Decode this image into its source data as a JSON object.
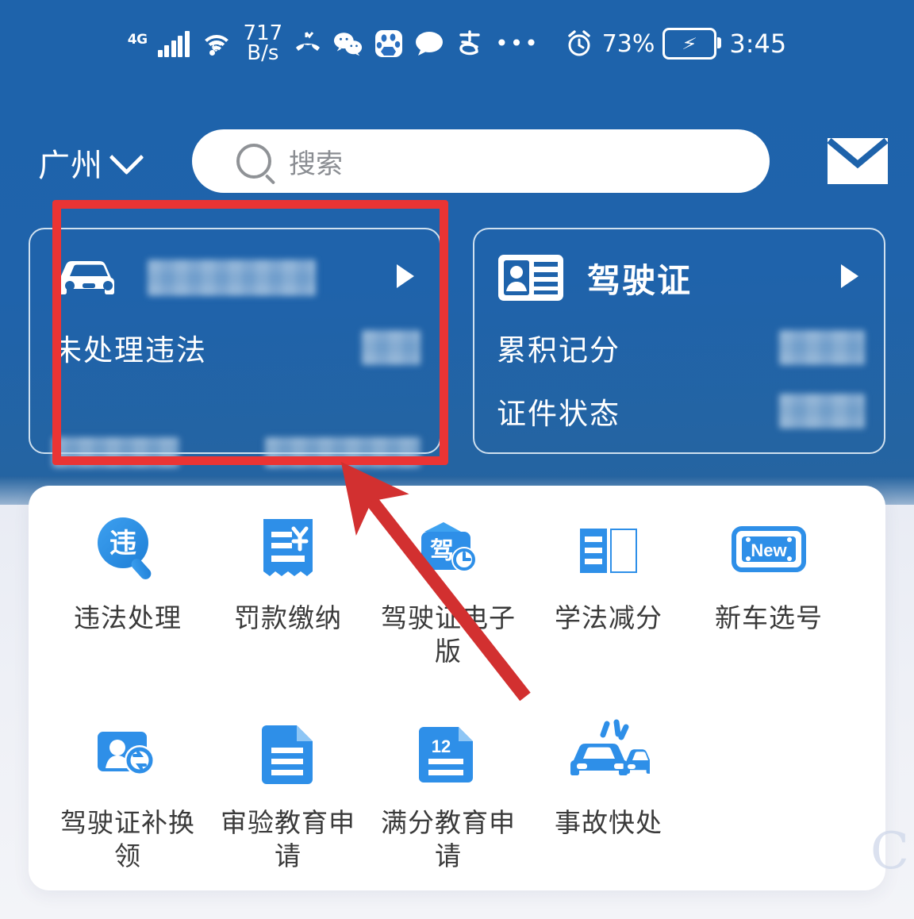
{
  "status_bar": {
    "network_type": "4G",
    "net_speed_value": "717",
    "net_speed_unit": "B/s",
    "icons": [
      "signal-bars-icon",
      "wifi-icon",
      "missed-call-icon",
      "wechat-icon",
      "baidu-icon",
      "message-bubble-icon",
      "alipay-icon",
      "more-dots-icon",
      "alarm-clock-icon"
    ],
    "more_dots": "•••",
    "battery_percent": "73%",
    "battery_state": "charging",
    "time": "3:45"
  },
  "header": {
    "city": "广州",
    "city_chevron": "chevron-down-icon",
    "search_placeholder": "搜索",
    "search_value": "",
    "mail_icon": "envelope-icon"
  },
  "cards": [
    {
      "icon": "car-icon",
      "title": "",
      "title_redacted": true,
      "caret": "play-arrow-icon",
      "rows": [
        {
          "label": "未处理违法",
          "value": "",
          "value_redacted": true
        },
        {
          "label": "",
          "label_redacted": true,
          "value": "",
          "value_redacted": true
        }
      ]
    },
    {
      "icon": "id-card-icon",
      "title": "驾驶证",
      "title_redacted": false,
      "caret": "play-arrow-icon",
      "rows": [
        {
          "label": "累积记分",
          "value": "",
          "value_redacted": true
        },
        {
          "label": "证件状态",
          "value": "",
          "value_redacted": true
        }
      ]
    }
  ],
  "services": [
    {
      "label": "违法处理",
      "icon": "violation-search-icon",
      "glyph": "违"
    },
    {
      "label": "罚款缴纳",
      "icon": "receipt-yuan-icon",
      "glyph": "¥"
    },
    {
      "label": "驾驶证电子版",
      "icon": "digital-license-icon",
      "glyph": "驾"
    },
    {
      "label": "学法减分",
      "icon": "open-book-icon",
      "glyph": ""
    },
    {
      "label": "新车选号",
      "icon": "new-plate-icon",
      "glyph": "New"
    },
    {
      "label": "驾驶证补换领",
      "icon": "license-renew-icon",
      "glyph": ""
    },
    {
      "label": "审验教育申请",
      "icon": "document-icon",
      "glyph": ""
    },
    {
      "label": "满分教育申请",
      "icon": "document-12-icon",
      "glyph": "12"
    },
    {
      "label": "事故快处",
      "icon": "crash-cars-icon",
      "glyph": ""
    }
  ],
  "annotations": {
    "highlight_box_color": "#ea3434",
    "arrow_color": "#d23030",
    "arrow_from": "driver-license-digital-service",
    "arrow_to": "vehicle-violation-card"
  },
  "watermark": "C",
  "colors": {
    "hero_blue": "#1e63ab",
    "accent_blue": "#2e8fe8",
    "panel_white": "#ffffff",
    "label_gray": "#3a3a3a"
  }
}
